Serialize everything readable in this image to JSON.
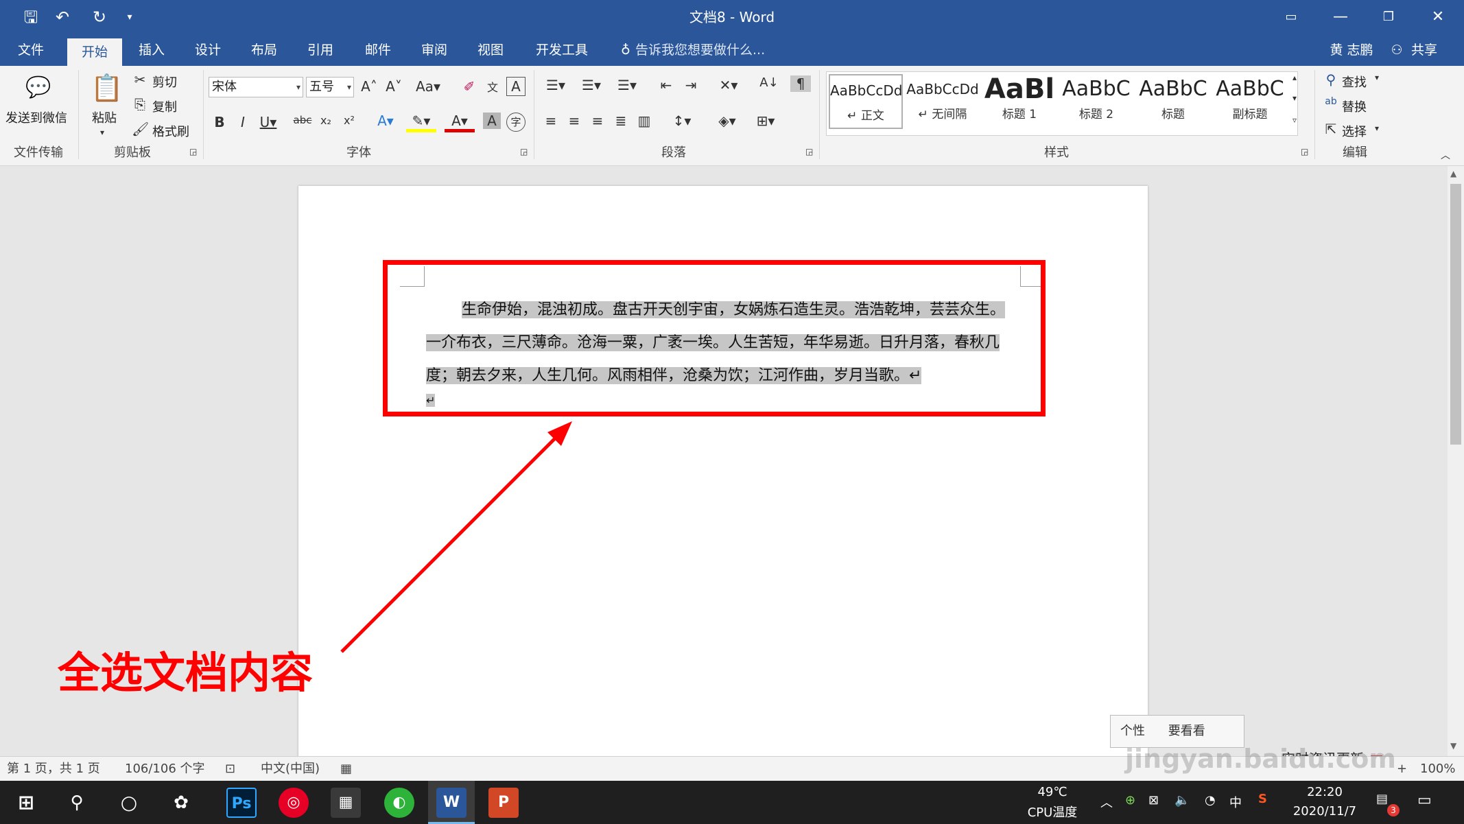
{
  "window": {
    "title": "文档8 - Word"
  },
  "tabs": [
    "文件",
    "开始",
    "插入",
    "设计",
    "布局",
    "引用",
    "邮件",
    "审阅",
    "视图",
    "开发工具"
  ],
  "tell_me": "告诉我您想要做什么...",
  "user": {
    "name": "黄 志鹏",
    "share": "共享"
  },
  "ribbon": {
    "send_wechat": "发送到微信",
    "group_file_transfer": "文件传输",
    "paste": "粘贴",
    "cut": "剪切",
    "copy": "复制",
    "format_painter": "格式刷",
    "group_clipboard": "剪贴板",
    "font_name": "宋体",
    "font_size": "五号",
    "group_font": "字体",
    "group_paragraph": "段落",
    "group_styles": "样式",
    "group_edit": "编辑",
    "find": "查找",
    "replace": "替换",
    "select": "选择",
    "styles": [
      {
        "preview": "AaBbCcDd",
        "name": "↵ 正文"
      },
      {
        "preview": "AaBbCcDd",
        "name": "↵ 无间隔"
      },
      {
        "preview": "AaBl",
        "name": "标题 1"
      },
      {
        "preview": "AaBbC",
        "name": "标题 2"
      },
      {
        "preview": "AaBbC",
        "name": "标题"
      },
      {
        "preview": "AaBbC",
        "name": "副标题"
      }
    ]
  },
  "document": {
    "lines": [
      "生命伊始，混浊初成。盘古开天创宇宙，女娲炼石造生灵。浩浩乾坤，芸芸众生。",
      "一介布衣，三尺薄命。沧海一粟，广袤一埃。人生苦短，年华易逝。日升月落，春秋几",
      "度；朝去夕来，人生几何。风雨相伴，沧桑为饮；江河作曲，岁月当歌。↵",
      "↵"
    ]
  },
  "annotation": "全选文档内容",
  "status": {
    "page": "第 1 页，共 1 页",
    "words": "106/106 个字",
    "language": "中文(中国)",
    "zoom": "100%"
  },
  "popup": {
    "text1": "个性",
    "text2": "要看看",
    "news": "实时资讯更新"
  },
  "taskbar": {
    "temp": "49℃",
    "temp_label": "CPU温度",
    "ime": "中",
    "time": "22:20",
    "date": "2020/11/7",
    "notif_count": "3"
  },
  "watermark": "jingyan.baidu.com"
}
